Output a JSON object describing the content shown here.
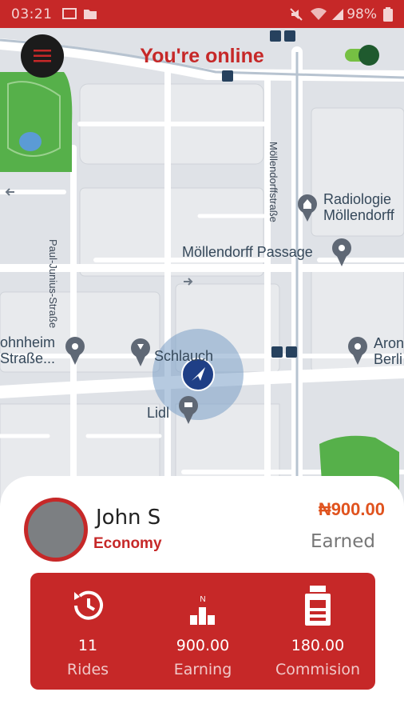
{
  "status_bar": {
    "time": "03:21",
    "battery": "98%"
  },
  "header": {
    "title": "You're online",
    "online_toggle": true
  },
  "map": {
    "street_labels": [
      "Paul-Junius-Straße",
      "Möllendorffstraße"
    ],
    "places": [
      {
        "name": "Radiologie\nMöllendorff"
      },
      {
        "name": "Möllendorff Passage"
      },
      {
        "name": "ohnheim\nStraße..."
      },
      {
        "name": "Schlauch"
      },
      {
        "name": "Lidl"
      },
      {
        "name": "Aron\nBerli"
      }
    ]
  },
  "driver": {
    "name": "John S",
    "ride_type": "Economy"
  },
  "earnings": {
    "amount": "₦900.00",
    "label": "Earned"
  },
  "stats": [
    {
      "value": "11",
      "label": "Rides",
      "icon": "history-icon"
    },
    {
      "value": "900.00",
      "label": "Earning",
      "icon": "earnings-chart-icon",
      "icon_caption": "N"
    },
    {
      "value": "180.00",
      "label": "Commision",
      "icon": "receipt-icon"
    }
  ],
  "colors": {
    "brand": "#c62828",
    "amount": "#e0531e"
  }
}
